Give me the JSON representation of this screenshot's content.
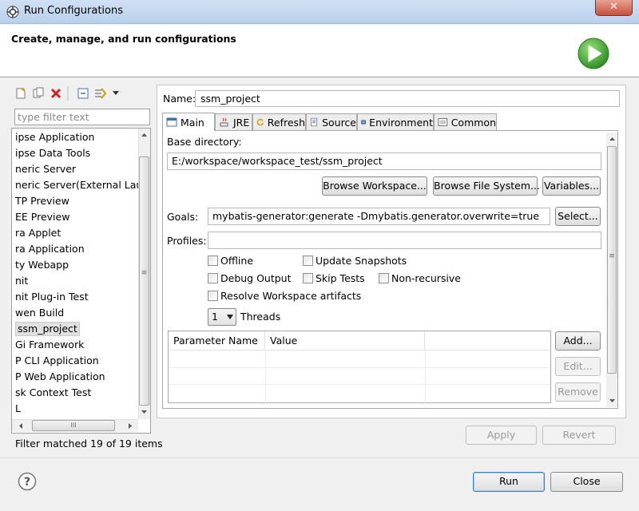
{
  "window": {
    "title": "Run Configurations",
    "close_glyph": "✕"
  },
  "header": {
    "title": "Create, manage, and run configurations",
    "icon": "run-icon"
  },
  "left": {
    "filter_placeholder": "type filter text",
    "items": [
      "ipse Application",
      "ipse Data Tools",
      "neric Server",
      "neric Server(External Launc",
      "TP Preview",
      "EE Preview",
      "ra Applet",
      "ra Application",
      "ty Webapp",
      "nit",
      "nit Plug-in Test",
      "wen Build",
      "ssm_project",
      "Gi Framework",
      "P CLI Application",
      "P Web Application",
      "sk Context Test",
      "L"
    ],
    "selected_index": 12,
    "hscroll_grip": "III",
    "vscroll_grip": "≡",
    "status": "Filter matched 19 of 19 items"
  },
  "config": {
    "name_label": "Name:",
    "name_value": "ssm_project",
    "tabs": [
      "Main",
      "JRE",
      "Refresh",
      "Source",
      "Environment",
      "Common"
    ],
    "active_tab": 0,
    "base_dir_label": "Base directory:",
    "base_dir_value": "E:/workspace/workspace_test/ssm_project",
    "browse_workspace": "Browse Workspace...",
    "browse_fs": "Browse File System...",
    "variables": "Variables...",
    "goals_label": "Goals:",
    "goals_value": "mybatis-generator:generate -Dmybatis.generator.overwrite=true",
    "select": "Select...",
    "profiles_label": "Profiles:",
    "profiles_value": "",
    "checkboxes": {
      "offline": "Offline",
      "update_snapshots": "Update Snapshots",
      "debug_output": "Debug Output",
      "skip_tests": "Skip Tests",
      "non_recursive": "Non-recursive",
      "resolve_workspace": "Resolve Workspace artifacts"
    },
    "threads_value": "1",
    "threads_label": "Threads",
    "table_headers": [
      "Parameter Name",
      "Value"
    ],
    "add": "Add...",
    "edit": "Edit...",
    "remove": "Remove",
    "apply": "Apply",
    "revert": "Revert"
  },
  "footer": {
    "run": "Run",
    "close": "Close",
    "help_glyph": "?"
  },
  "colors": {
    "run_icon_green": "#3fa535",
    "delete_red": "#d42020"
  }
}
